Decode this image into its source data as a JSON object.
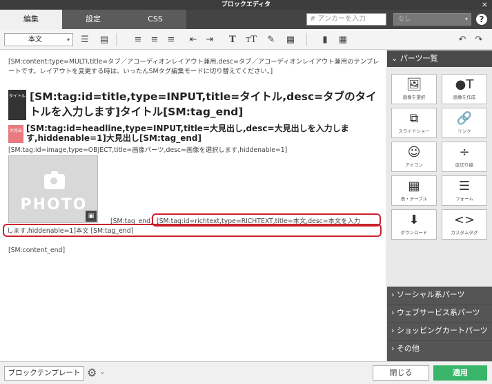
{
  "window": {
    "title": "ブロックエディタ",
    "close": "×"
  },
  "tabs": [
    {
      "label": "編集",
      "active": true
    },
    {
      "label": "設定"
    },
    {
      "label": "CSS"
    }
  ],
  "header": {
    "anchor_placeholder": "# アンカーを入力",
    "none_select": "なし",
    "help": "?"
  },
  "toolbar": {
    "paragraph_select": "本文",
    "icons": [
      "bullet-list-icon",
      "numbered-list-icon",
      "align-left-icon",
      "align-center-icon",
      "align-right-icon",
      "outdent-icon",
      "indent-icon",
      "font-icon",
      "font-size-icon",
      "color-picker-icon",
      "table-icon",
      "paste-icon",
      "special-icon",
      "undo-icon",
      "redo-icon"
    ]
  },
  "editor": {
    "content_start": "[SM:content:type=MULTI,title=タブ／アコーディオンレイアウト兼用,desc=タブ／アコーディオンレイアウト兼用のテンプレートです。レイアウトを変更する時は、いったんSMタグ編集モードに切り替えてください。]",
    "title_badge": "タイトル",
    "title_tag": "[SM:tag:id=title,type=INPUT,title=タイトル,desc=タブのタイトルを入力します]タイトル[SM:tag_end]",
    "headline_badge": "大見出",
    "headline_tag": "[SM:tag:id=headline,type=INPUT,title=大見出し,desc=大見出しを入力します,hiddenable=1]大見出し[SM:tag_end]",
    "image_tag": "[SM:tag:id=image,type=OBJECT,title=画像パーツ,desc=画像を選択します,hiddenable=1]",
    "photo_word": "PHOTO",
    "image_tag_end": "[SM:tag_end]",
    "richtext_line1": "[SM:tag:id=richtext,type=RICHTEXT,title=本文,desc=本文を入力",
    "richtext_line2": "します,hiddenable=1]本文 [SM:tag_end]",
    "content_end": "[SM:content_end]"
  },
  "sidebar": {
    "header": "パーツ一覧",
    "parts": [
      {
        "icon": "image-select-icon",
        "glyph": "🖼",
        "label": "画像を選択"
      },
      {
        "icon": "image-create-icon",
        "glyph": "●T",
        "label": "画像を作成"
      },
      {
        "icon": "slideshow-icon",
        "glyph": "⧉",
        "label": "スライドショー"
      },
      {
        "icon": "link-icon",
        "glyph": "🔗",
        "label": "リンク"
      },
      {
        "icon": "smiley-icon",
        "glyph": "☺",
        "label": "アイコン"
      },
      {
        "icon": "divider-icon",
        "glyph": "÷",
        "label": "区切り線"
      },
      {
        "icon": "table-icon",
        "glyph": "▦",
        "label": "表・テーブル"
      },
      {
        "icon": "form-icon",
        "glyph": "☰",
        "label": "フォーム"
      },
      {
        "icon": "download-icon",
        "glyph": "⬇",
        "label": "ダウンロード"
      },
      {
        "icon": "custom-tag-icon",
        "glyph": "<>",
        "label": "カスタムタグ"
      }
    ],
    "categories": [
      "ソーシャル系パーツ",
      "ウェブサービス系パーツ",
      "ショッピングカートパーツ",
      "その他"
    ]
  },
  "footer": {
    "template_button": "ブロックテンプレート",
    "close_button": "閉じる",
    "apply_button": "適用"
  }
}
